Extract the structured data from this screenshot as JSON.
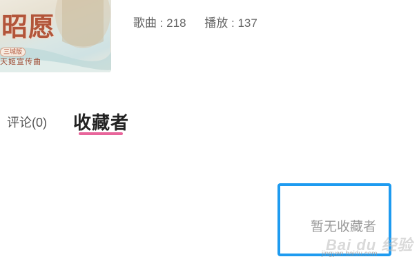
{
  "album": {
    "cover_title": "昭愿",
    "cover_badge": "三城版",
    "cover_subtitle": "天姬宣传曲"
  },
  "stats": {
    "songs": "歌曲 : 218",
    "plays": "播放 : 137"
  },
  "tabs": [
    {
      "label": "评论(0)",
      "active": false
    },
    {
      "label": "收藏者",
      "active": true
    }
  ],
  "empty_state": {
    "text": "暂无收藏者"
  },
  "watermark": {
    "main": "Bai du 经验",
    "sub": "jingyan.baidu.com"
  },
  "colors": {
    "tab_underline": "#e8659b",
    "highlight_box": "#1e9bf0"
  }
}
